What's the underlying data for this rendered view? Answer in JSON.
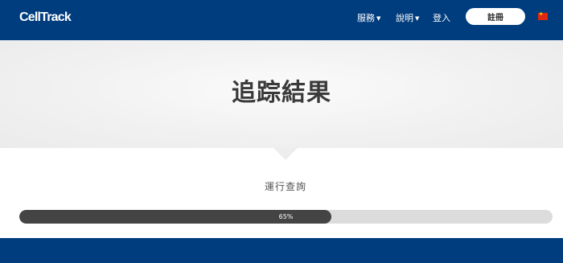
{
  "header": {
    "logo": "CellTrack",
    "nav": {
      "services": "服務",
      "help": "說明",
      "login": "登入",
      "register": "註冊"
    },
    "language_flag": "cn-flag-icon",
    "colors": {
      "bar": "#003d7e"
    }
  },
  "hero": {
    "title": "追踪結果"
  },
  "progress": {
    "status": "運行查詢",
    "value_percent": 65,
    "label": "65%"
  }
}
